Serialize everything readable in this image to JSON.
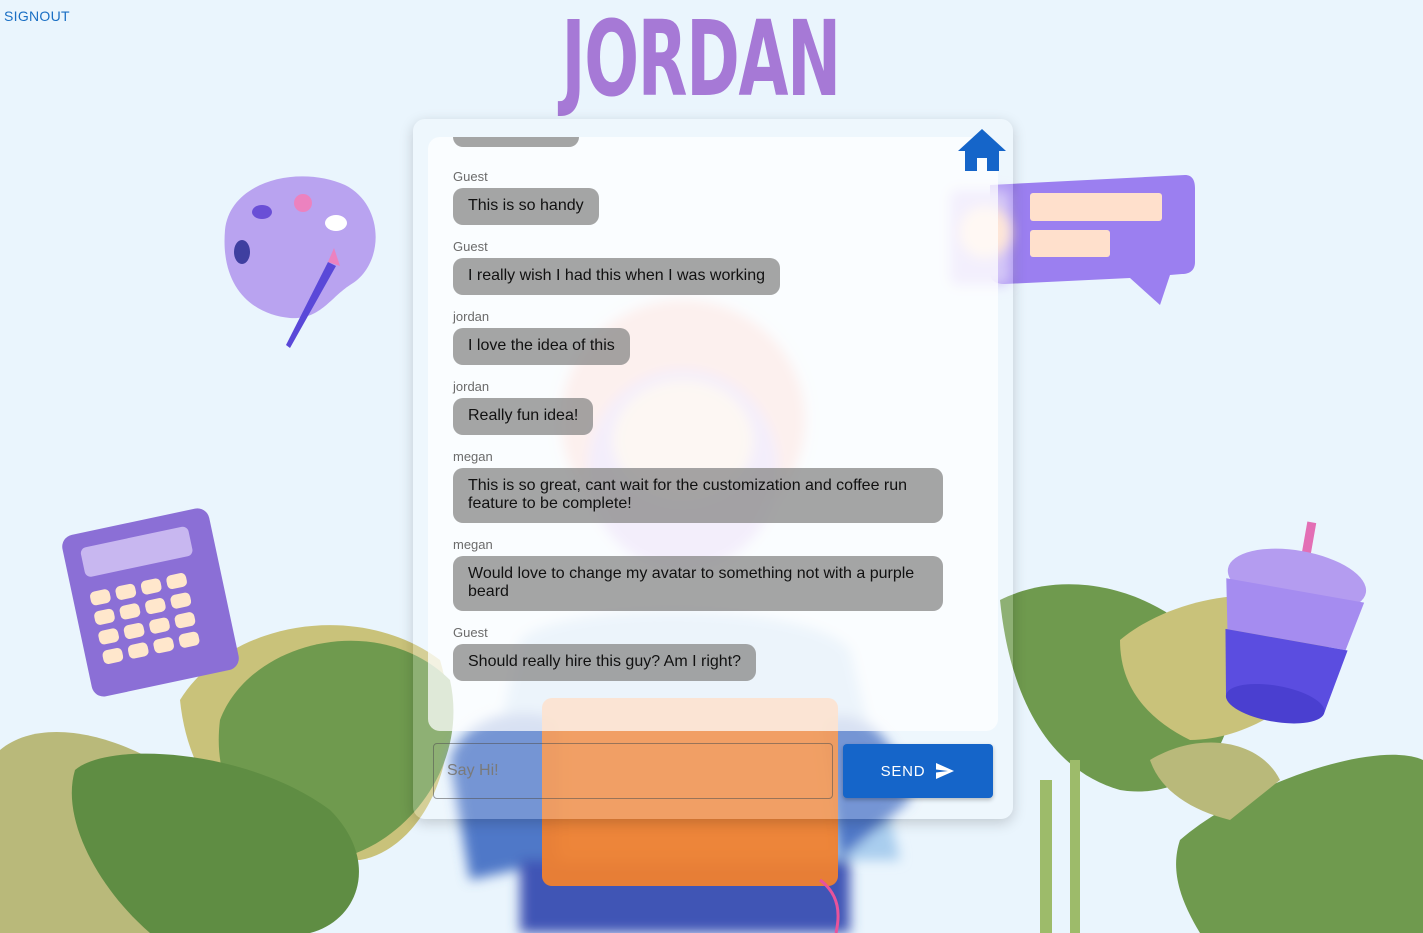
{
  "header": {
    "signout_label": "SIGNOUT",
    "title": "JORDAN"
  },
  "chat": {
    "partial_bubble": "...",
    "messages": [
      {
        "sender": "Guest",
        "text": "This is so handy"
      },
      {
        "sender": "Guest",
        "text": "I really wish I had this when I was working"
      },
      {
        "sender": "jordan",
        "text": "I love the idea of this"
      },
      {
        "sender": "jordan",
        "text": "Really fun idea!"
      },
      {
        "sender": "megan",
        "text": "This is so great, cant wait for the customization and coffee run feature to be complete!"
      },
      {
        "sender": "megan",
        "text": "Would love to change my avatar to something not with a purple beard"
      },
      {
        "sender": "Guest",
        "text": "Should really hire this guy? Am I right?"
      }
    ]
  },
  "composer": {
    "placeholder": "Say Hi!",
    "value": "",
    "send_label": "SEND"
  },
  "icons": {
    "home": "home-icon",
    "send": "send-icon"
  },
  "colors": {
    "title": "#a679d6",
    "send_button": "#1565c9",
    "home_icon": "#1565c9",
    "background": "#eaf5fd"
  }
}
